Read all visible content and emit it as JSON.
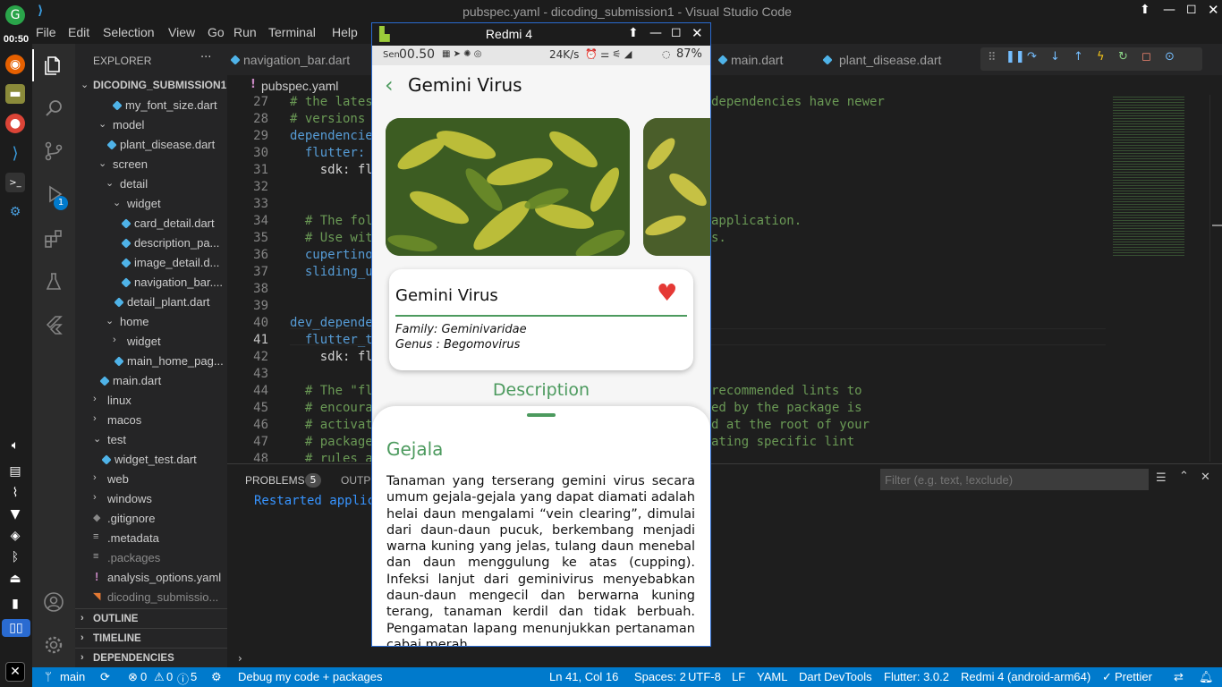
{
  "system": {
    "clock": "00:50"
  },
  "window": {
    "title": "pubspec.yaml - dicoding_submission1 - Visual Studio Code"
  },
  "menu": [
    "File",
    "Edit",
    "Selection",
    "View",
    "Go",
    "Run",
    "Terminal",
    "Help"
  ],
  "explorer": {
    "header": "EXPLORER",
    "more": "···",
    "root": "DICODING_SUBMISSION1",
    "items": [
      {
        "label": "my_font_size.dart"
      },
      {
        "label": "model"
      },
      {
        "label": "plant_disease.dart"
      },
      {
        "label": "screen"
      },
      {
        "label": "detail"
      },
      {
        "label": "widget"
      },
      {
        "label": "card_detail.dart"
      },
      {
        "label": "description_pa..."
      },
      {
        "label": "image_detail.d..."
      },
      {
        "label": "navigation_bar...."
      },
      {
        "label": "detail_plant.dart"
      },
      {
        "label": "home"
      },
      {
        "label": "widget"
      },
      {
        "label": "main_home_pag..."
      },
      {
        "label": "main.dart"
      },
      {
        "label": "linux"
      },
      {
        "label": "macos"
      },
      {
        "label": "test"
      },
      {
        "label": "widget_test.dart"
      },
      {
        "label": "web"
      },
      {
        "label": "windows"
      },
      {
        "label": ".gitignore"
      },
      {
        "label": ".metadata"
      },
      {
        "label": ".packages"
      },
      {
        "label": "analysis_options.yaml"
      },
      {
        "label": "dicoding_submissio..."
      }
    ],
    "sections": [
      "OUTLINE",
      "TIMELINE",
      "DEPENDENCIES"
    ]
  },
  "tabs": [
    {
      "label": "navigation_bar.dart"
    },
    {
      "label": "main.dart"
    },
    {
      "label": "plant_disease.dart"
    }
  ],
  "breadcrumb": {
    "marker": "!",
    "file": "pubspec.yaml"
  },
  "editor": {
    "lines": [
      {
        "n": "27",
        "text": "# the lates",
        "tail": "dependencies have newer",
        "cls": "cmt"
      },
      {
        "n": "28",
        "text": "# versions",
        "tail": "",
        "cls": "cmt"
      },
      {
        "n": "29",
        "text": "dependencie",
        "tail": "",
        "cls": "key"
      },
      {
        "n": "30",
        "text": "  flutter:",
        "tail": "",
        "cls": "key"
      },
      {
        "n": "31",
        "text": "    sdk: fl",
        "tail": "",
        "cls": "plain"
      },
      {
        "n": "32",
        "text": "",
        "tail": "",
        "cls": "plain"
      },
      {
        "n": "33",
        "text": "",
        "tail": "",
        "cls": "plain"
      },
      {
        "n": "34",
        "text": "  # The fol",
        "tail": "application.",
        "cls": "cmt"
      },
      {
        "n": "35",
        "text": "  # Use wit",
        "tail": "s.",
        "cls": "cmt"
      },
      {
        "n": "36",
        "text": "  cupertino",
        "tail": "",
        "cls": "key"
      },
      {
        "n": "37",
        "text": "  sliding_u",
        "tail": "",
        "cls": "key"
      },
      {
        "n": "38",
        "text": "",
        "tail": "",
        "cls": "plain"
      },
      {
        "n": "39",
        "text": "",
        "tail": "",
        "cls": "plain"
      },
      {
        "n": "40",
        "text": "dev_depende",
        "tail": "",
        "cls": "key"
      },
      {
        "n": "41",
        "text": "  flutter_t",
        "tail": "",
        "cls": "key"
      },
      {
        "n": "42",
        "text": "    sdk: fl",
        "tail": "",
        "cls": "plain"
      },
      {
        "n": "43",
        "text": "",
        "tail": "",
        "cls": "plain"
      },
      {
        "n": "44",
        "text": "  # The \"fl",
        "tail": "recommended lints to",
        "cls": "cmt"
      },
      {
        "n": "45",
        "text": "  # encoura",
        "tail": "ed by the package is",
        "cls": "cmt"
      },
      {
        "n": "46",
        "text": "  # activat",
        "tail": "d at the root of your",
        "cls": "cmt"
      },
      {
        "n": "47",
        "text": "  # package",
        "tail": "ating specific lint",
        "cls": "cmt"
      },
      {
        "n": "48",
        "text": "  # rules a",
        "tail": "",
        "cls": "cmt"
      }
    ]
  },
  "panel": {
    "problems_label": "PROBLEMS",
    "problems_count": "5",
    "output_label": "OUTPU",
    "filter_placeholder": "Filter (e.g. text, !exclude)",
    "output_text": "Restarted applic"
  },
  "statusbar": {
    "branch": "main",
    "errors": "0",
    "warnings": "0",
    "infos": "5",
    "debug": "Debug my code + packages",
    "position": "Ln 41, Col 16",
    "spaces": "Spaces: 2",
    "encoding": "UTF-8",
    "eol": "LF",
    "language": "YAML",
    "devtools": "Dart DevTools",
    "flutter": "Flutter: 3.0.2",
    "device": "Redmi 4 (android-arm64)",
    "prettier": "Prettier"
  },
  "emulator": {
    "title": "Redmi 4",
    "status": {
      "day": "Sen",
      "time": "00.50",
      "speed": "24K/s",
      "battery": "87%"
    },
    "app": {
      "title": "Gemini Virus",
      "card_title": "Gemini Virus",
      "family": "Family: Geminivaridae",
      "genus": "Genus : Begomovirus",
      "description_label": "Description",
      "section_title": "Gejala",
      "body": "Tanaman yang terserang gemini virus secara umum gejala-gejala yang dapat diamati adalah helai daun mengalami “vein clearing”, dimulai dari daun-daun pucuk, berkembang menjadi warna kuning yang jelas, tulang daun menebal dan daun menggulung ke atas (cupping). Infeksi lanjut dari geminivirus menyebabkan daun-daun mengecil dan berwarna kuning terang, tanaman kerdil dan tidak berbuah. Pengamatan lapang menunjukkan pertanaman cabai merah"
    },
    "accent": "#4c9a5e",
    "heart": "#e53935"
  }
}
